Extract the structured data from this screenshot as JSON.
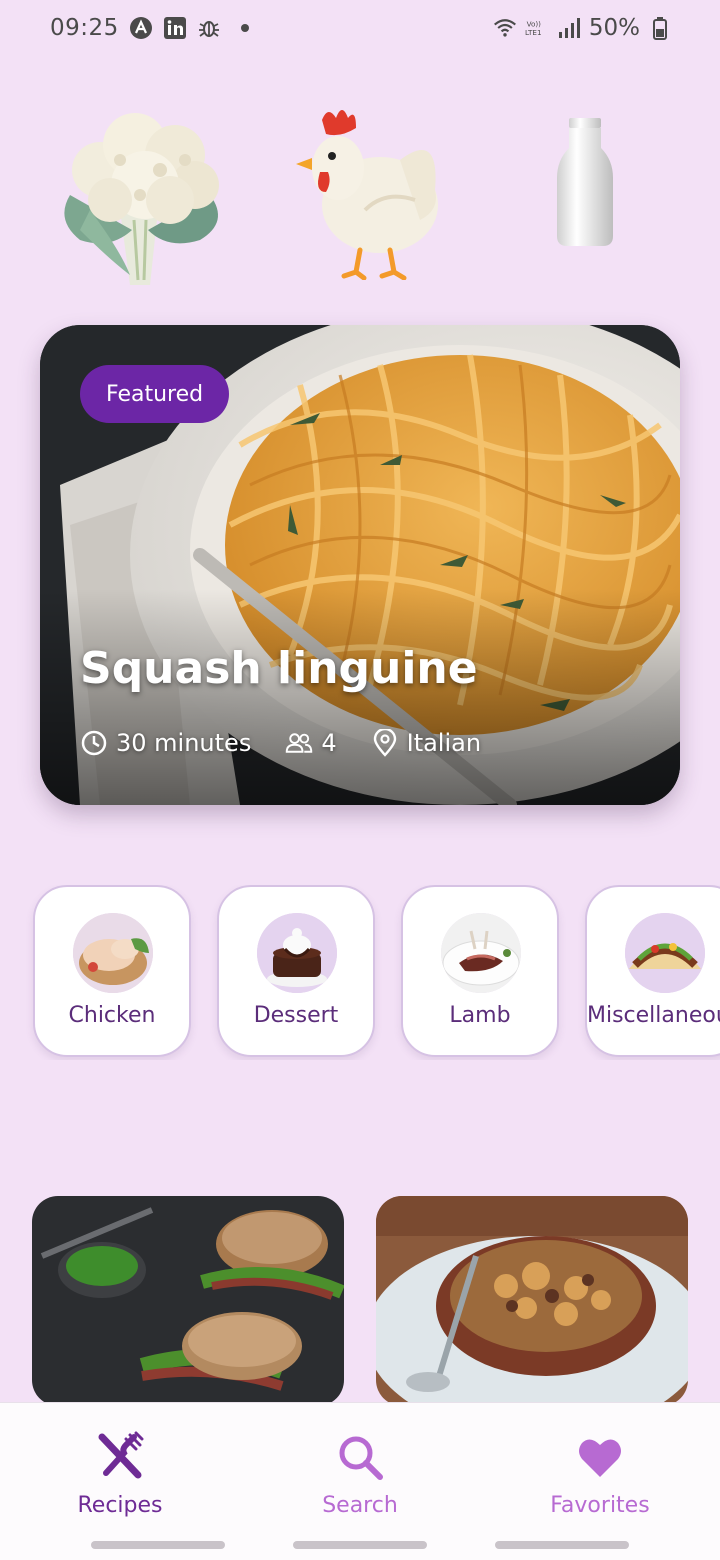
{
  "status_bar": {
    "time": "09:25",
    "battery": "50%",
    "icons": [
      "nav-app-icon",
      "linkedin-icon",
      "bug-icon",
      "dot-icon",
      "wifi-icon",
      "volte-icon",
      "signal-icon",
      "battery-icon"
    ]
  },
  "ingredients": [
    "cauliflower",
    "chicken",
    "milk"
  ],
  "featured": {
    "badge": "Featured",
    "title": "Squash linguine",
    "time": "30 minutes",
    "servings": "4",
    "cuisine": "Italian"
  },
  "categories": [
    {
      "label": "Chicken"
    },
    {
      "label": "Dessert"
    },
    {
      "label": "Lamb"
    },
    {
      "label": "Miscellaneous"
    }
  ],
  "recipes": [
    "steak-sandwich",
    "stew-bowl"
  ],
  "nav": {
    "recipes": "Recipes",
    "search": "Search",
    "favorites": "Favorites"
  },
  "colors": {
    "background": "#f3e1f6",
    "accent": "#6c26a6",
    "nav_inactive": "#b76ad2"
  }
}
